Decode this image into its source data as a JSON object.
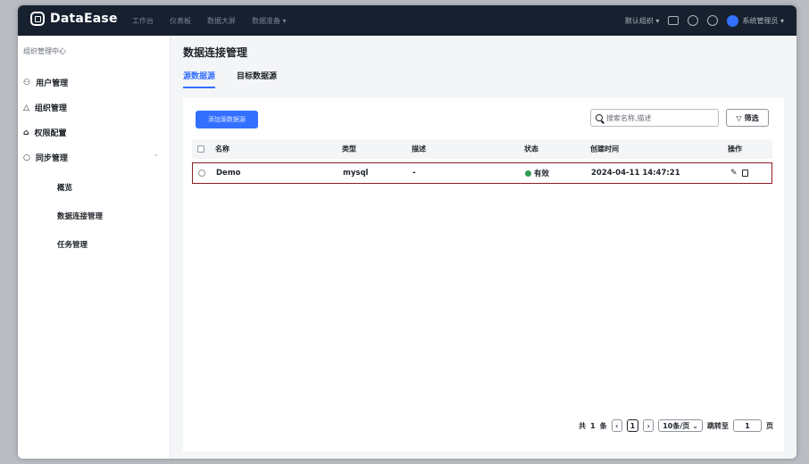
{
  "app": {
    "name": "DataEase"
  },
  "topnav": {
    "items": [
      "工作台",
      "仪表板",
      "数据大屏",
      "数据准备 ▾"
    ]
  },
  "topright": {
    "org": "默认组织 ▾",
    "user": "系统管理员 ▾"
  },
  "sidebar": {
    "title": "组织管理中心",
    "items": [
      {
        "label": "用户管理"
      },
      {
        "label": "组织管理"
      },
      {
        "label": "权限配置"
      },
      {
        "label": "同步管理"
      }
    ],
    "sub": [
      {
        "label": "概览"
      },
      {
        "label": "数据连接管理"
      },
      {
        "label": "任务管理"
      }
    ]
  },
  "page": {
    "title": "数据连接管理"
  },
  "tabs": [
    {
      "label": "源数据源"
    },
    {
      "label": "目标数据源"
    }
  ],
  "toolbar": {
    "add_label": "添加源数据源",
    "search_placeholder": "搜索名称,描述",
    "filter_label": "筛选"
  },
  "table": {
    "headers": {
      "name": "名称",
      "type": "类型",
      "desc": "描述",
      "status": "状态",
      "created": "创建时间",
      "actions": "操作"
    },
    "rows": [
      {
        "name": "Demo",
        "type": "mysql",
        "desc": "-",
        "status": "有效",
        "created": "2024-04-11 14:47:21"
      }
    ]
  },
  "pagination": {
    "total_prefix": "共",
    "total": "1",
    "total_suffix": "条",
    "current_page": "1",
    "page_size": "10条/页",
    "jump_label": "跳转至",
    "jump_value": "1",
    "jump_suffix": "页"
  },
  "colors": {
    "accent": "#3370ff",
    "topbar": "#17202f",
    "row_highlight": "#8d1d24",
    "status_ok": "#2f9e4f"
  }
}
